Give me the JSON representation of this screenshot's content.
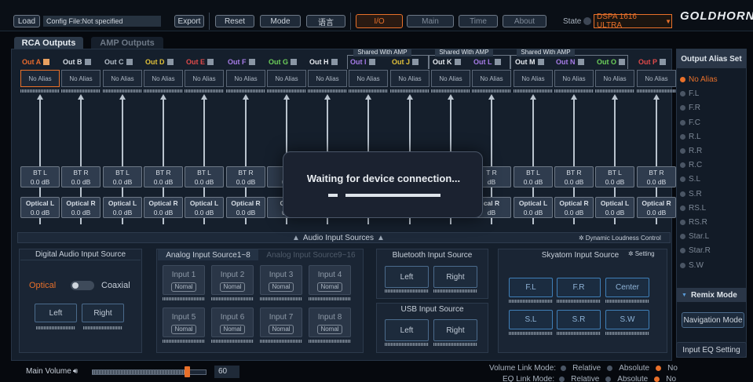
{
  "toolbar": {
    "load": "Load",
    "config_file": "Config File:Not specified",
    "export": "Export",
    "reset": "Reset",
    "mode": "Mode",
    "language": "语言",
    "tab_io": "I/O",
    "tab_main": "Main",
    "tab_time": "Time",
    "tab_about": "About",
    "state_label": "State",
    "device": "DSPA 1616 ULTRA",
    "logo": "GOLDHORN"
  },
  "subtabs": {
    "rca": "RCA Outputs",
    "amp": "AMP Outputs"
  },
  "shared_label": "Shared With AMP",
  "outputs": [
    {
      "name": "Out A",
      "color": "#e86a2c",
      "alias": "No Alias"
    },
    {
      "name": "Out B",
      "color": "#d7dde4",
      "alias": "No Alias"
    },
    {
      "name": "Out C",
      "color": "#b4bec9",
      "alias": "No Alias"
    },
    {
      "name": "Out D",
      "color": "#e0c03a",
      "alias": "No Alias"
    },
    {
      "name": "Out E",
      "color": "#e04a4a",
      "alias": "No Alias"
    },
    {
      "name": "Out F",
      "color": "#a77ce8",
      "alias": "No Alias"
    },
    {
      "name": "Out G",
      "color": "#6ccf5a",
      "alias": "No Alias"
    },
    {
      "name": "Out H",
      "color": "#e6eaef",
      "alias": "No Alias"
    },
    {
      "name": "Out I",
      "color": "#a77ce8",
      "alias": "No Alias"
    },
    {
      "name": "Out J",
      "color": "#e0c03a",
      "alias": "No Alias"
    },
    {
      "name": "Out K",
      "color": "#e6eaef",
      "alias": "No Alias"
    },
    {
      "name": "Out L",
      "color": "#a77ce8",
      "alias": "No Alias"
    },
    {
      "name": "Out M",
      "color": "#e6eaef",
      "alias": "No Alias"
    },
    {
      "name": "Out N",
      "color": "#a77ce8",
      "alias": "No Alias"
    },
    {
      "name": "Out O",
      "color": "#6ccf5a",
      "alias": "No Alias"
    },
    {
      "name": "Out P",
      "color": "#e04a4a",
      "alias": "No Alias"
    }
  ],
  "bt_row": [
    {
      "label": "BT L",
      "value": "0.0 dB"
    },
    {
      "label": "BT R",
      "value": "0.0 dB"
    },
    {
      "label": "BT L",
      "value": "0.0 dB"
    },
    {
      "label": "BT R",
      "value": "0.0 dB"
    },
    {
      "label": "BT L",
      "value": "0.0 dB"
    },
    {
      "label": "BT R",
      "value": "0.0 dB"
    },
    {
      "label": "BT",
      "value": "0.0"
    },
    {
      "label": "",
      "value": ""
    },
    {
      "label": "",
      "value": ""
    },
    {
      "label": "",
      "value": ""
    },
    {
      "label": "",
      "value": ""
    },
    {
      "label": "T R",
      "value": "dB"
    },
    {
      "label": "BT L",
      "value": "0.0 dB"
    },
    {
      "label": "BT R",
      "value": "0.0 dB"
    },
    {
      "label": "BT L",
      "value": "0.0 dB"
    },
    {
      "label": "BT R",
      "value": "0.0 dB"
    }
  ],
  "opt_row": [
    {
      "label": "Optical L",
      "value": "0.0 dB"
    },
    {
      "label": "Optical R",
      "value": "0.0 dB"
    },
    {
      "label": "Optical L",
      "value": "0.0 dB"
    },
    {
      "label": "Optical R",
      "value": "0.0 dB"
    },
    {
      "label": "Optical L",
      "value": "0.0 dB"
    },
    {
      "label": "Optical R",
      "value": "0.0 dB"
    },
    {
      "label": "Opti",
      "value": "0.0"
    },
    {
      "label": "",
      "value": ""
    },
    {
      "label": "",
      "value": ""
    },
    {
      "label": "",
      "value": ""
    },
    {
      "label": "",
      "value": ""
    },
    {
      "label": "cal R",
      "value": "dB"
    },
    {
      "label": "Optical L",
      "value": "0.0 dB"
    },
    {
      "label": "Optical R",
      "value": "0.0 dB"
    },
    {
      "label": "Optical L",
      "value": "0.0 dB"
    },
    {
      "label": "Optical R",
      "value": "0.0 dB"
    }
  ],
  "audio_sources": {
    "title": "Audio Input Sources",
    "dynamic": "Dynamic Loudness Control",
    "digital_title": "Digital Audio Input Source",
    "optical": "Optical",
    "coaxial": "Coaxial",
    "left": "Left",
    "right": "Right",
    "analog_tab1": "Analog Input Source1~8",
    "analog_tab2": "Analog Input Source9~16",
    "inputs": [
      "Input 1",
      "Input 2",
      "Input 3",
      "Input 4",
      "Input 5",
      "Input 6",
      "Input 7",
      "Input 8"
    ],
    "nomal": "Nomal",
    "bt_title": "Bluetooth Input Source",
    "usb_title": "USB Input Source",
    "skyatom_title": "Skyatom Input Source",
    "setting": "Setting",
    "sky_row1": [
      "F.L",
      "F.R",
      "Center"
    ],
    "sky_row2": [
      "S.L",
      "S.R",
      "S.W"
    ]
  },
  "bottom": {
    "main_volume": "Main Volume",
    "volume_value": "60",
    "volume_level": 0.83,
    "volume_link": "Volume Link Mode:",
    "eq_link": "EQ Link Mode:",
    "relative": "Relative",
    "absolute": "Absolute",
    "no": "No"
  },
  "sidebar": {
    "title": "Output Alias Set",
    "items": [
      "No Alias",
      "F.L",
      "F.R",
      "F.C",
      "R.L",
      "R.R",
      "R.C",
      "S.L",
      "S.R",
      "RS.L",
      "RS.R",
      "Star.L",
      "Star.R",
      "S.W"
    ],
    "remix": "Remix Mode",
    "navigation": "Navigation Mode",
    "input_eq": "Input EQ Setting"
  },
  "modal": {
    "message": "Waiting for device connection..."
  },
  "colors": {
    "accent": "#e8702a",
    "panel": "#151f2c"
  }
}
